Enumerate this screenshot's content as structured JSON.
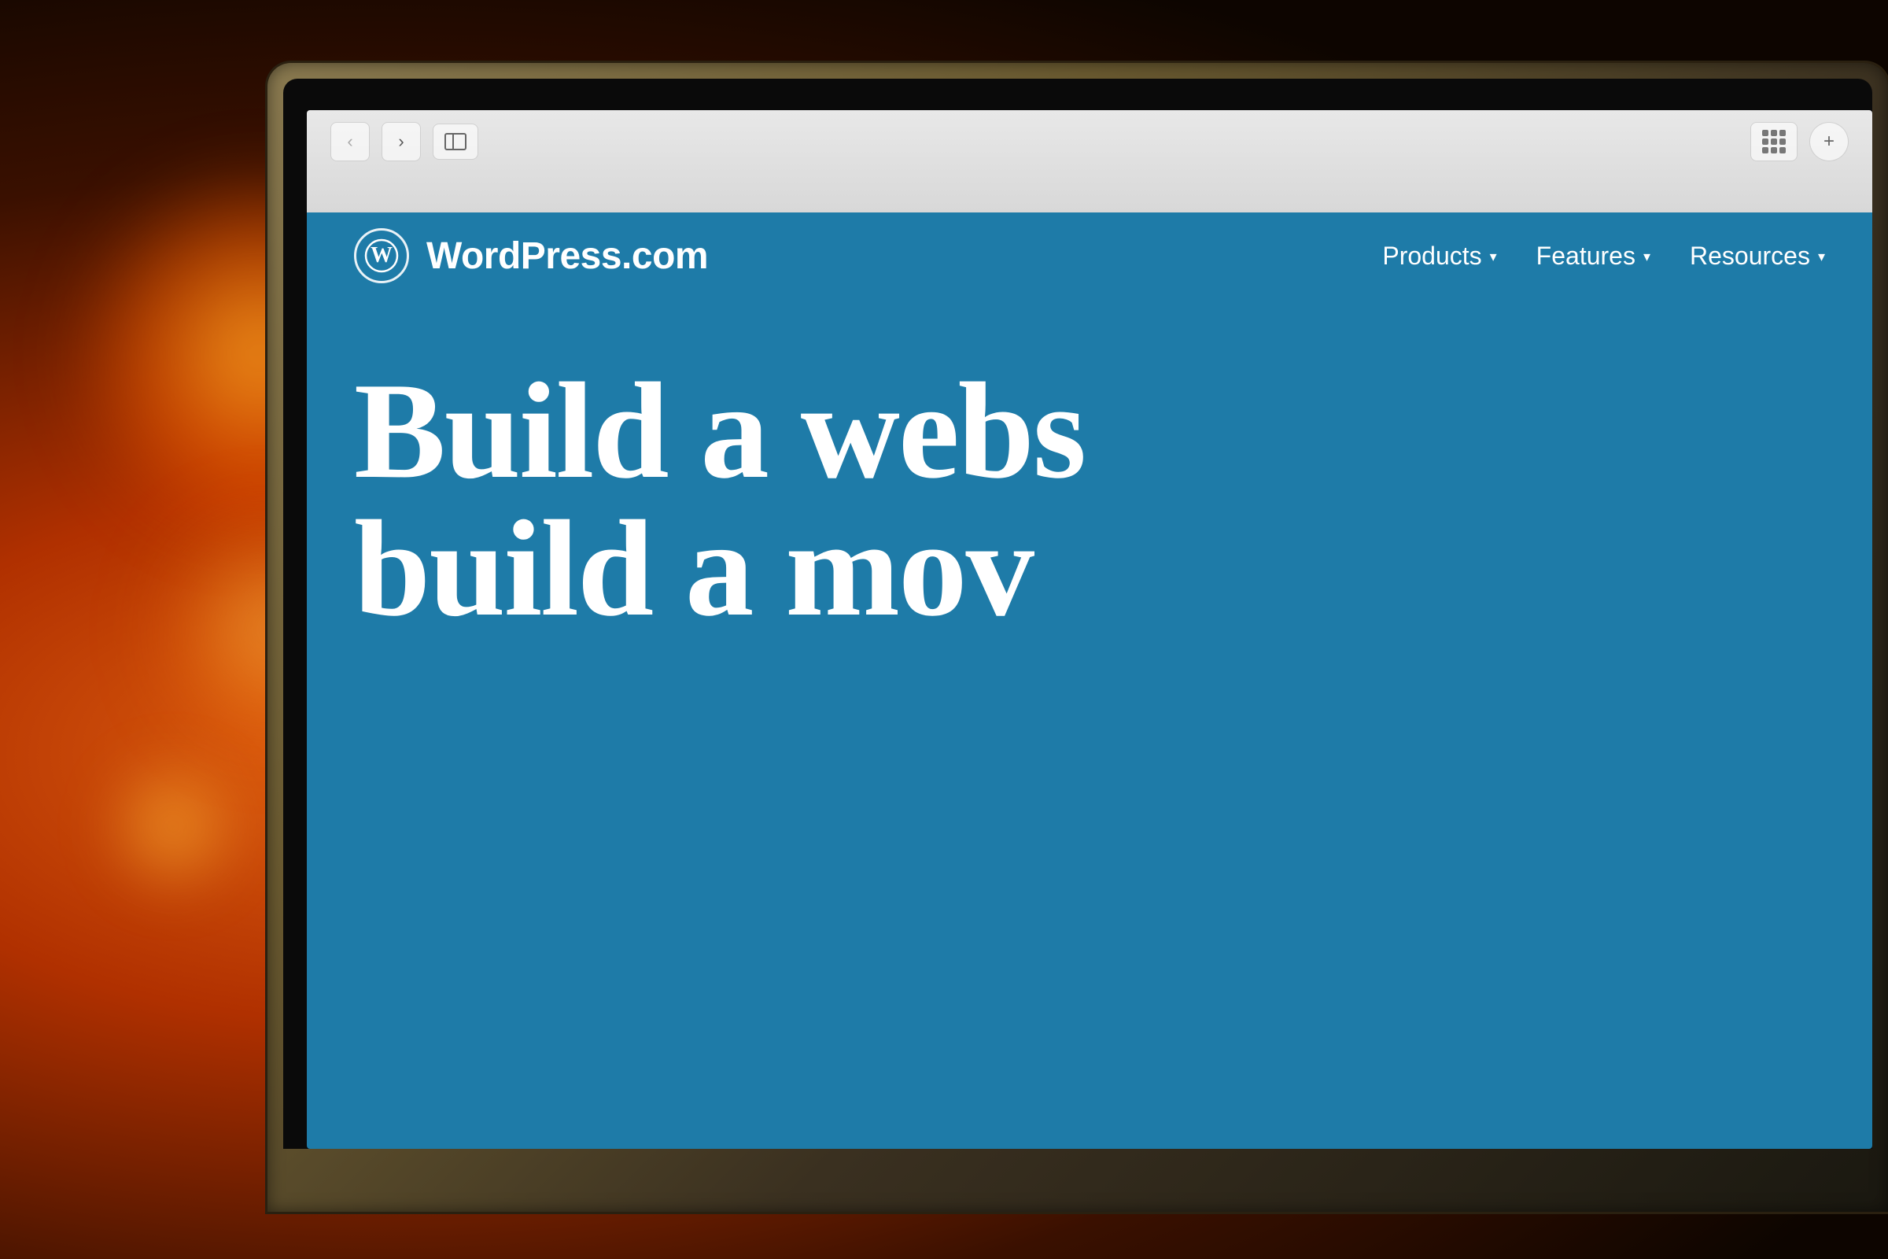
{
  "background": {
    "description": "Warm bokeh background with orange/amber light source"
  },
  "browser": {
    "back_button_label": "‹",
    "forward_button_label": "›",
    "grid_button_title": "Grid view",
    "plus_button_label": "+",
    "back_disabled": true,
    "forward_enabled": true
  },
  "website": {
    "logo_symbol": "W",
    "site_name": "WordPress.com",
    "nav_items": [
      {
        "label": "Products",
        "has_dropdown": true
      },
      {
        "label": "Features",
        "has_dropdown": true
      },
      {
        "label": "Resources",
        "has_dropdown": true
      }
    ],
    "hero_line1": "Build a webs",
    "hero_line2": "build a mov"
  }
}
